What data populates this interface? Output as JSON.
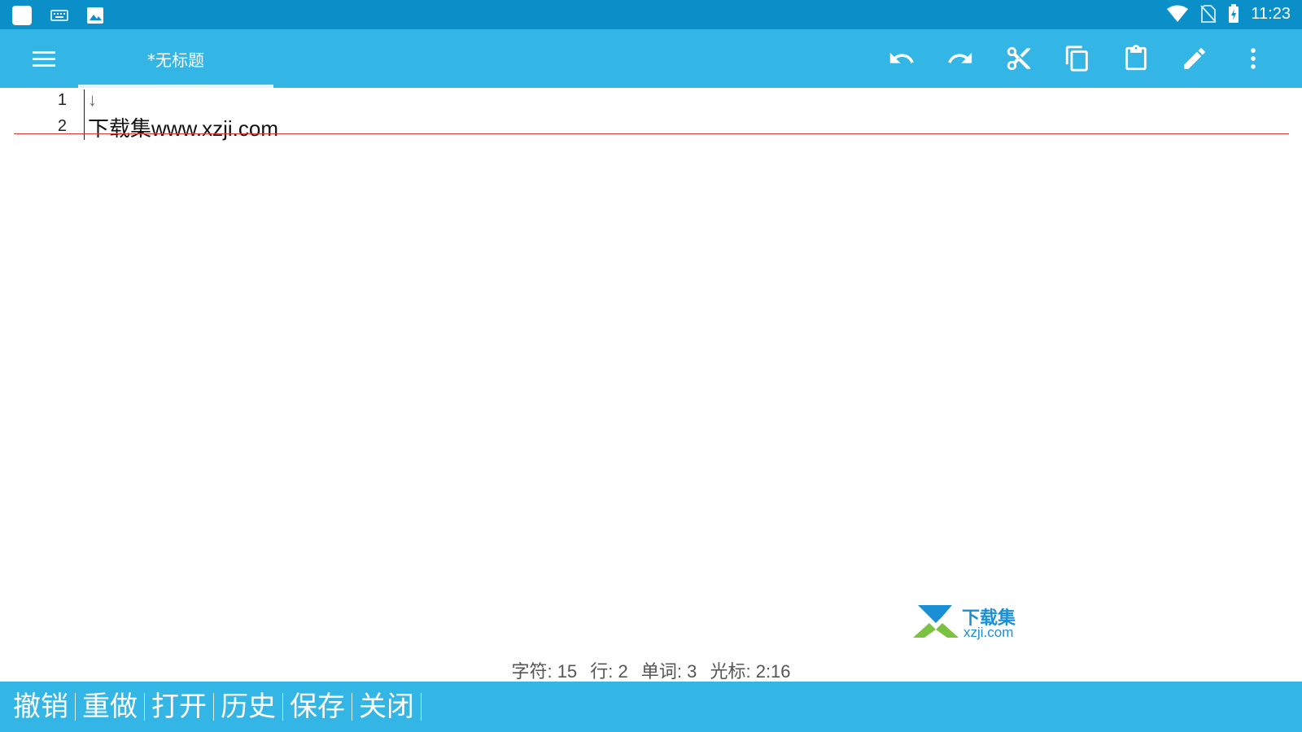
{
  "status_bar": {
    "time": "11:23",
    "left_icons": [
      "app-square-icon",
      "keyboard-icon",
      "image-icon"
    ],
    "right_icons": [
      "wifi-icon",
      "no-sim-icon",
      "battery-charging-icon"
    ]
  },
  "app_bar": {
    "menu_icon": "hamburger-menu-icon",
    "tab_title": "*无标题",
    "actions": [
      "undo-icon",
      "redo-icon",
      "cut-icon",
      "copy-icon",
      "paste-icon",
      "edit-icon",
      "more-vert-icon"
    ]
  },
  "editor": {
    "lines": [
      {
        "number": "1",
        "text": "↓"
      },
      {
        "number": "2",
        "text": "下载集www.xzji.com"
      }
    ]
  },
  "watermark": {
    "title": "下载集",
    "url": "xzji.com"
  },
  "status_info": {
    "chars": "字符: 15",
    "lines": "行: 2",
    "words": "单词: 3",
    "cursor": "光标: 2:16"
  },
  "bottom_bar": {
    "buttons": [
      "撤销",
      "重做",
      "打开",
      "历史",
      "保存",
      "关闭"
    ]
  },
  "colors": {
    "status_bar": "#0b8fc8",
    "app_bar": "#33b5e5",
    "current_line": "#e53935",
    "watermark": "#1a8fd6"
  }
}
